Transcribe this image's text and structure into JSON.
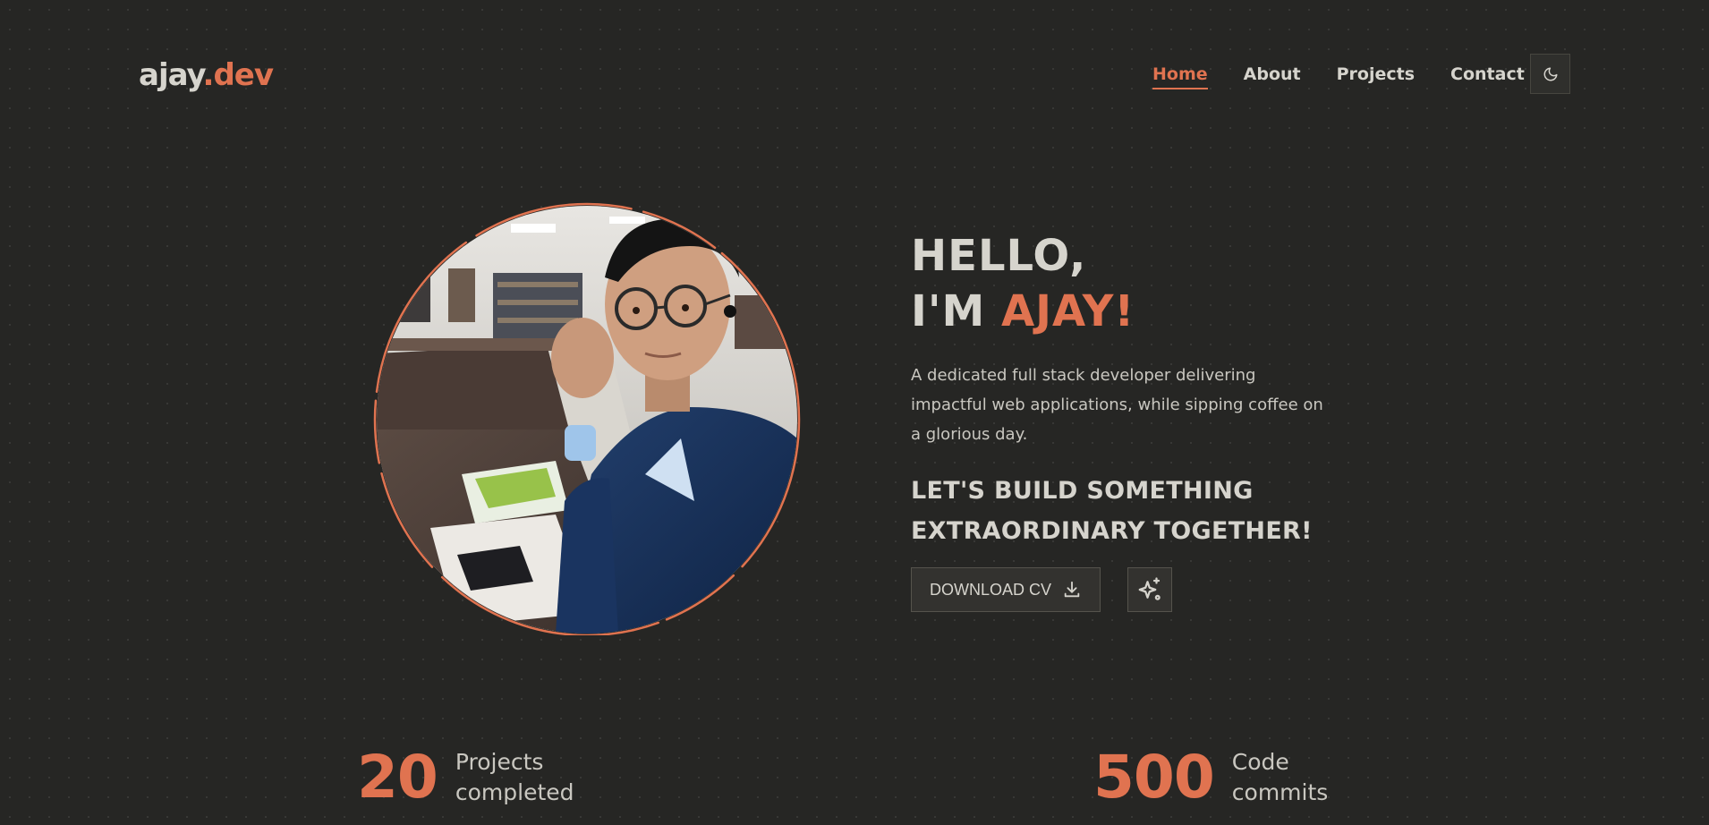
{
  "header": {
    "logo_main": "ajay",
    "logo_accent": ".dev",
    "nav": [
      {
        "label": "Home",
        "active": true
      },
      {
        "label": "About",
        "active": false
      },
      {
        "label": "Projects",
        "active": false
      },
      {
        "label": "Contact",
        "active": false
      }
    ],
    "theme_toggle_icon": "moon-icon"
  },
  "hero": {
    "greeting_line1": "HELLO,",
    "greeting_prefix": "I'M ",
    "greeting_name": "AJAY!",
    "intro": "A dedicated full stack developer delivering impactful web applications, while sipping coffee on a glorious day.",
    "cta": "LET'S BUILD SOMETHING EXTRAORDINARY TOGETHER!",
    "download_label": "DOWNLOAD CV",
    "download_icon": "download-icon",
    "sparkle_icon": "sparkles-icon",
    "photo_icon": "profile-photo"
  },
  "stats": [
    {
      "value": "20",
      "label": "Projects completed"
    },
    {
      "value": "500",
      "label": "Code commits"
    }
  ],
  "colors": {
    "background": "#262624",
    "accent": "#e07350",
    "text": "#d6d4cd"
  }
}
